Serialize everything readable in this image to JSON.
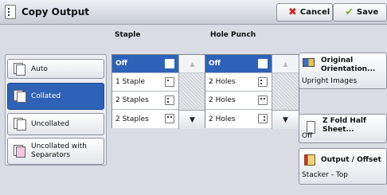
{
  "header": {
    "title": "Copy Output",
    "cancel_label": "Cancel",
    "save_label": "Save"
  },
  "collation": {
    "items": [
      {
        "label": "Auto",
        "selected": false
      },
      {
        "label": "Collated",
        "selected": true
      },
      {
        "label": "Uncollated",
        "selected": false
      },
      {
        "label": "Uncollated with Separators",
        "selected": false
      }
    ]
  },
  "staple": {
    "header": "Staple",
    "options": [
      "Off",
      "1 Staple",
      "2 Staples",
      "2 Staples"
    ]
  },
  "hole_punch": {
    "header": "Hole Punch",
    "options": [
      "Off",
      "2 Holes",
      "2 Holes",
      "2 Holes"
    ]
  },
  "right_panel": {
    "orientation": {
      "label": "Original Orientation...",
      "value": "Upright Images"
    },
    "zfold": {
      "label": "Z Fold Half Sheet...",
      "value": "Off"
    },
    "output": {
      "label": "Output / Offset",
      "value": "Stacker - Top"
    }
  },
  "colors": {
    "accent": "#2d62b8",
    "cancel": "#d8231f",
    "save": "#7bb229"
  }
}
